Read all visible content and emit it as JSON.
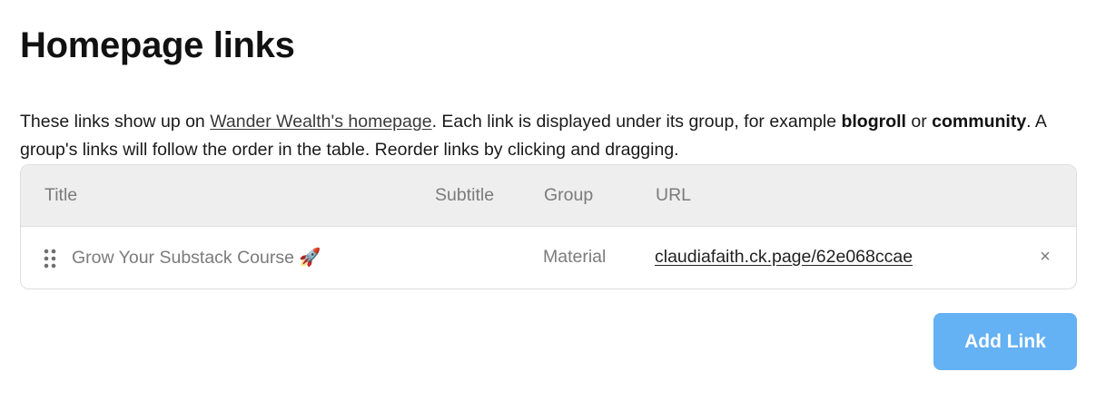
{
  "page": {
    "title": "Homepage links"
  },
  "description": {
    "part1": "These links show up on ",
    "link_text": "Wander Wealth's homepage",
    "part2": ". Each link is displayed under its group, for example ",
    "bold1": "blogroll",
    "part3": " or ",
    "bold2": "community",
    "part4": ". A group's links will follow the order in the table. Reorder links by clicking and dragging."
  },
  "table": {
    "columns": {
      "title": "Title",
      "subtitle": "Subtitle",
      "group": "Group",
      "url": "URL"
    },
    "rows": [
      {
        "title": "Grow Your Substack Course 🚀",
        "subtitle": "",
        "group": "Material",
        "url": "claudiafaith.ck.page/62e068ccae",
        "remove_symbol": "×"
      }
    ]
  },
  "actions": {
    "add_link_label": "Add Link"
  },
  "colors": {
    "button_bg": "#64b1f4",
    "header_bg": "#eeeeee",
    "muted_text": "#7b7b7b"
  },
  "icons": {
    "drag": "drag-handle-icon",
    "remove": "close-icon"
  }
}
